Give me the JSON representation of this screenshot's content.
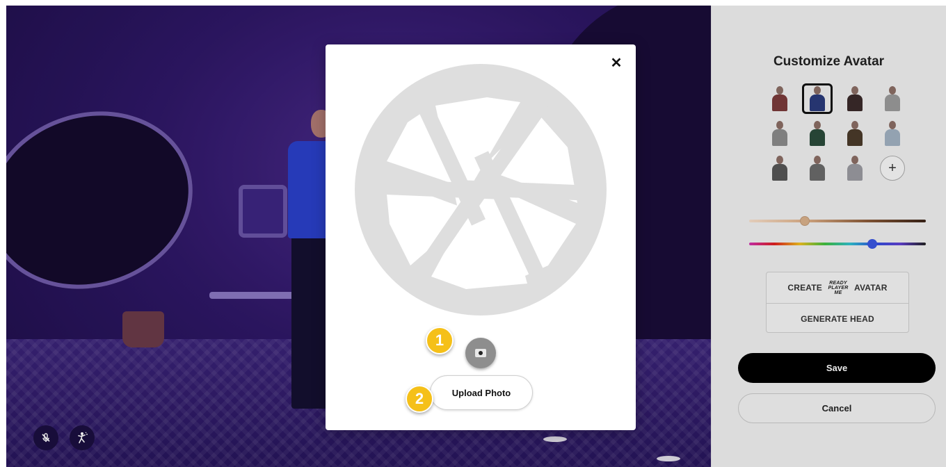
{
  "panel": {
    "title": "Customize Avatar",
    "avatars": [
      {
        "name": "avatar-1",
        "body_color": "#7a3a3a",
        "selected": false
      },
      {
        "name": "avatar-2",
        "body_color": "#2a3a7a",
        "selected": true
      },
      {
        "name": "avatar-3",
        "body_color": "#3a2a2a",
        "selected": false
      },
      {
        "name": "avatar-4",
        "body_color": "#9a9a9a",
        "selected": false
      },
      {
        "name": "avatar-5",
        "body_color": "#8a8a8a",
        "selected": false
      },
      {
        "name": "avatar-6",
        "body_color": "#2a4a3a",
        "selected": false
      },
      {
        "name": "avatar-7",
        "body_color": "#4a3a2a",
        "selected": false
      },
      {
        "name": "avatar-8",
        "body_color": "#a0b0c0",
        "selected": false
      },
      {
        "name": "avatar-9",
        "body_color": "#555555",
        "selected": false
      },
      {
        "name": "avatar-10",
        "body_color": "#6a6a6a",
        "selected": false
      },
      {
        "name": "avatar-11",
        "body_color": "#9a9aa0",
        "selected": false
      }
    ],
    "add_label": "+",
    "skin_tone_level": 0.29,
    "hue_level": 0.7,
    "create_label": "CREATE",
    "rpm_logo": "READY PLAYER ME",
    "avatar_label": "AVATAR",
    "generate_head_label": "GENERATE HEAD",
    "save_label": "Save",
    "cancel_label": "Cancel"
  },
  "modal": {
    "close_label": "✕",
    "camera_icon": "camera-icon",
    "upload_label": "Upload Photo"
  },
  "badges": {
    "step1": "1",
    "step2": "2",
    "color": "#f5c019"
  },
  "scene": {
    "mic_icon": "mic-off-icon",
    "gesture_icon": "gesture-icon"
  }
}
